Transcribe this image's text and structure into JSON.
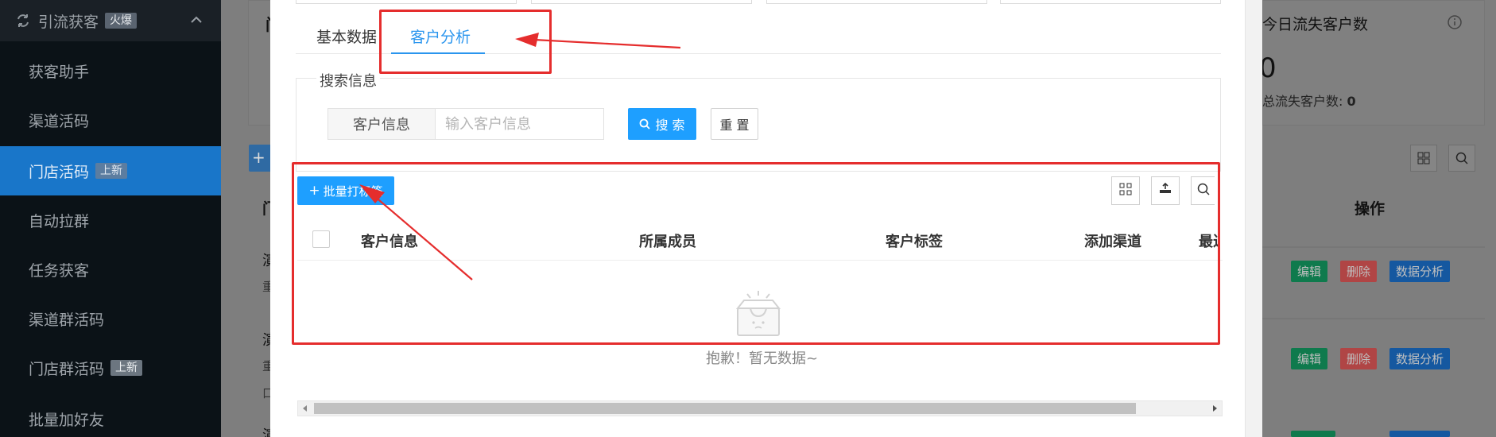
{
  "sidebar": {
    "group_title": "引流获客",
    "group_badge": "火爆",
    "items": [
      {
        "label": "获客助手",
        "badge": ""
      },
      {
        "label": "渠道活码",
        "badge": ""
      },
      {
        "label": "门店活码",
        "badge": "上新",
        "active": true
      },
      {
        "label": "自动拉群",
        "badge": ""
      },
      {
        "label": "任务获客",
        "badge": ""
      },
      {
        "label": "渠道群活码",
        "badge": ""
      },
      {
        "label": "门店群活码",
        "badge": "上新"
      },
      {
        "label": "批量加好友",
        "badge": ""
      }
    ]
  },
  "background_page": {
    "left_col_header": "门",
    "left_col_glyph": "演",
    "left_col_glyph2": "重",
    "left_col_glyph3": "口",
    "right_stat_title": "今日流失客户数",
    "right_stat_value": "0",
    "right_stat_total_label": "总流失客户数:",
    "right_stat_total_value": "0",
    "ops_header": "操作",
    "row_buttons": {
      "edit": "编辑",
      "delete": "删除",
      "analysis": "数据分析"
    }
  },
  "modal": {
    "tabs": [
      {
        "label": "基本数据"
      },
      {
        "label": "客户分析",
        "active": true
      }
    ],
    "search_section_title": "搜索信息",
    "search_field_label": "客户信息",
    "search_field_placeholder": "输入客户信息",
    "search_field_value": "",
    "search_button": "搜 索",
    "reset_button": "重 置",
    "batch_tag_button": "批量打标签",
    "table": {
      "columns": [
        "客户信息",
        "所属成员",
        "客户标签",
        "添加渠道",
        "最近"
      ],
      "rows": []
    },
    "empty_text": "抱歉！暂无数据~"
  },
  "colors": {
    "primary": "#1e9fff",
    "sidebar_active": "#1976c9",
    "annotation_red": "#e52d2d",
    "edit_green": "#0f7a4d",
    "delete_red": "#b04545",
    "analysis_blue": "#1558a0"
  },
  "icons": {
    "sidebar_group": "refresh-arrows-icon",
    "collapse": "chevron-up-icon",
    "search": "search-icon",
    "columns_toggle": "grid-columns-icon",
    "export": "export-icon",
    "print_search": "magnifier-icon",
    "empty": "empty-box-icon",
    "info": "info-circle-icon"
  }
}
